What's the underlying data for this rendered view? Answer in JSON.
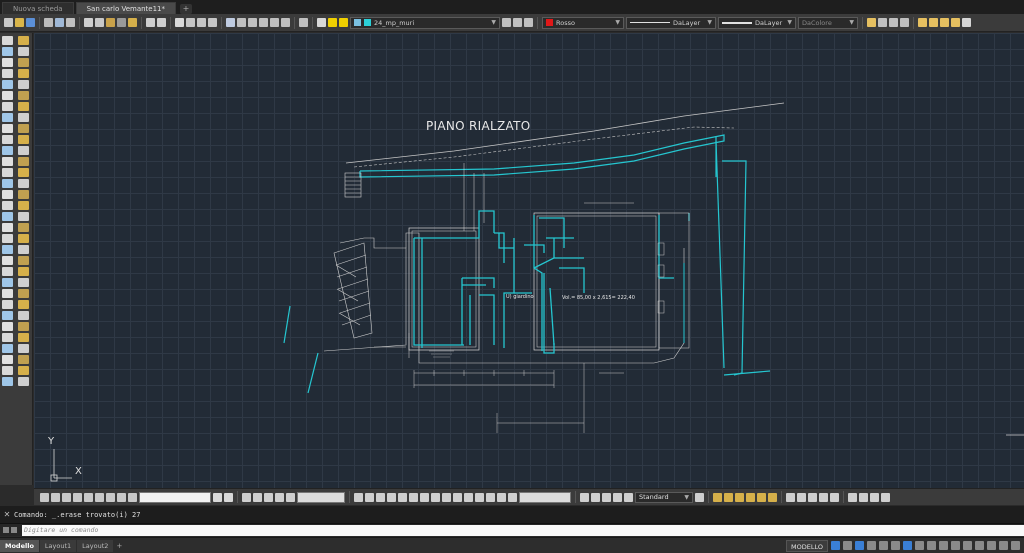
{
  "tabs": {
    "new_tab": "Nuova scheda",
    "file_tab": "San carlo Vemante11*"
  },
  "toolbar": {
    "layer_name": "24_mp_muri",
    "color_value": "Rosso",
    "color_swatch": "#e01818",
    "linetype_value": "DaLayer",
    "lineweight_value": "DaLayer",
    "plotstyle_value": "DaColore"
  },
  "drawing": {
    "title": "PIANO RIALZATO",
    "room_label": "U) giardino",
    "volume_label": "Vol.= 85,00 x 2,615= 222,40",
    "axis_x": "X",
    "axis_y": "Y"
  },
  "bottom_toolbar": {
    "text_style": "Standard"
  },
  "command": {
    "history_line": "Comando: _.erase trovato(i) 27",
    "prompt_placeholder": "Digitare un comando"
  },
  "status": {
    "layout_tabs": [
      "Modello",
      "Layout1",
      "Layout2"
    ],
    "model_button": "MODELLO"
  },
  "colors": {
    "canvas_bg": "#222b36",
    "cyan_walls": "#25c6d0",
    "white_lines": "#d8d8d8"
  }
}
